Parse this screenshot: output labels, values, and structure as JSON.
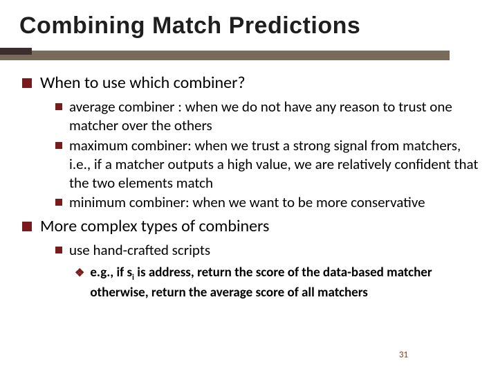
{
  "slide": {
    "title": "Combining Match Predictions",
    "page_number": "31",
    "bullets_l1": {
      "b0": "When to use which combiner?",
      "b1": "More complex types of combiners"
    },
    "bullets_l2": {
      "b0_0": "average combiner : when we do not have any reason to trust one matcher over the others",
      "b0_1": "maximum combiner: when we trust a strong signal from matchers, i.e., if a matcher outputs a high value, we are relatively confident that the two elements match",
      "b0_2": "minimum combiner: when we want to be more conservative",
      "b1_0": "use hand-crafted scripts"
    },
    "bullets_l3": {
      "b1_0_0_pre": "e.g., if s",
      "b1_0_0_sub": "i",
      "b1_0_0_post": " is address, return the score of the data-based matcher otherwise, return the average score of all matchers"
    }
  }
}
